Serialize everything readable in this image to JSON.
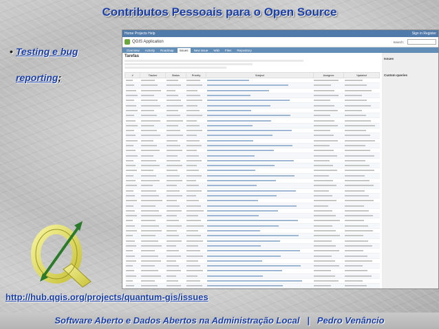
{
  "slide": {
    "title": "Contributos Pessoais para o Open Source",
    "bullet_line1": "Testing e bug",
    "bullet_line2": "reporting",
    "bullet_suffix": ";",
    "link": "http://hub.qgis.org/projects/quantum-gis/issues",
    "footer_left": "Software Aberto e Dados Abertos na Administração Local",
    "footer_sep": "|",
    "footer_right": "Pedro Venâncio"
  },
  "screenshot": {
    "project_title": "QGIS Application",
    "search_label": "Search:",
    "tabs": [
      "Overview",
      "Activity",
      "Roadmap",
      "Issues",
      "New issue",
      "Wiki",
      "Files",
      "Repository"
    ],
    "active_tab": "Issues",
    "issues_heading": "Tarefas",
    "table_headers": [
      "#",
      "Tracker",
      "Status",
      "Priority",
      "Subject",
      "Assignee",
      "Updated"
    ],
    "sidebar": {
      "heading1": "Issues",
      "heading2": "Custom queries"
    },
    "accent_color": "#507aaa"
  }
}
